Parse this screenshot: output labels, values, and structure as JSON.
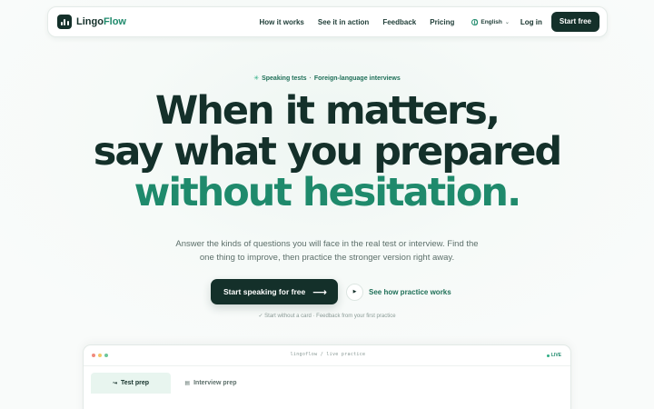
{
  "nav": {
    "logo_text_a": "Lingo",
    "logo_text_b": "Flow",
    "links": [
      "How it works",
      "See it in action",
      "Feedback",
      "Pricing"
    ],
    "language": "English",
    "login": "Log in",
    "start_button": "Start free"
  },
  "hero": {
    "eyebrow_a": "Speaking tests",
    "eyebrow_sep": "·",
    "eyebrow_b": "Foreign-language interviews",
    "headline_line1": "When it matters,",
    "headline_line2": "say what you prepared",
    "headline_line3": "without hesitation.",
    "subtext": "Answer the kinds of questions you will face in the real test or interview. Find the one thing to improve, then practice the stronger version right away.",
    "cta_primary": "Start speaking for free",
    "cta_secondary": "See how practice works",
    "note": "✓ Start without a card · Feedback from your first practice"
  },
  "preview": {
    "window_title": "lingoflow / live practice",
    "live_label": "LIVE",
    "tabs": [
      {
        "label": "Test prep",
        "icon": "arrow-icon",
        "active": true
      },
      {
        "label": "Interview prep",
        "icon": "window-icon",
        "active": false
      }
    ]
  },
  "colors": {
    "brand_dark": "#14302a",
    "accent": "#1f8a6c",
    "dot_red": "#f08a7c",
    "dot_yellow": "#f3c766",
    "dot_green": "#6cc79a"
  }
}
